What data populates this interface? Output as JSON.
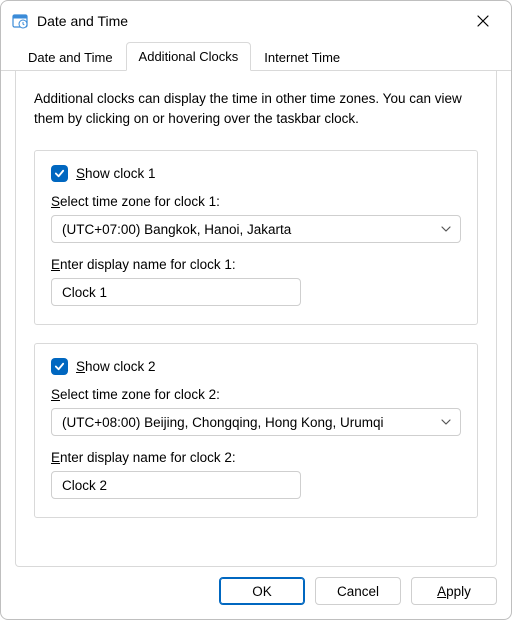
{
  "window": {
    "title": "Date and Time"
  },
  "tabs": {
    "t0": "Date and Time",
    "t1": "Additional Clocks",
    "t2": "Internet Time"
  },
  "desc": "Additional clocks can display the time in other time zones. You can view them by clicking on or hovering over the taskbar clock.",
  "clock1": {
    "show_prefix": "S",
    "show_rest": "how clock 1",
    "tz_label_prefix": "S",
    "tz_label_rest": "elect time zone for clock 1:",
    "tz_value": "(UTC+07:00) Bangkok, Hanoi, Jakarta",
    "name_label_prefix": "E",
    "name_label_rest": "nter display name for clock 1:",
    "name_value": "Clock 1"
  },
  "clock2": {
    "show_prefix": "S",
    "show_rest": "how clock 2",
    "tz_label_prefix": "S",
    "tz_label_rest": "elect time zone for clock 2:",
    "tz_value": "(UTC+08:00) Beijing, Chongqing, Hong Kong, Urumqi",
    "name_label_prefix": "E",
    "name_label_rest": "nter display name for clock 2:",
    "name_value": "Clock 2"
  },
  "buttons": {
    "ok": "OK",
    "cancel": "Cancel",
    "apply_prefix": "A",
    "apply_rest": "pply"
  }
}
